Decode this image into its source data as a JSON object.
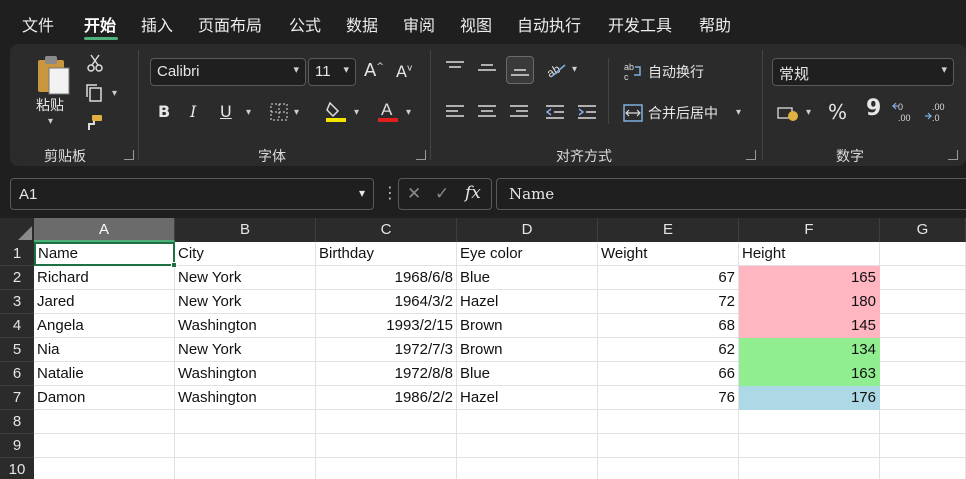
{
  "menu": {
    "items": [
      "文件",
      "开始",
      "插入",
      "页面布局",
      "公式",
      "数据",
      "审阅",
      "视图",
      "自动执行",
      "开发工具",
      "帮助"
    ],
    "active": "开始"
  },
  "ribbon": {
    "clipboard": {
      "paste_label": "粘贴",
      "group_label": "剪贴板"
    },
    "font": {
      "font_name": "Calibri",
      "font_size": "11",
      "bold": "B",
      "italic": "I",
      "underline": "U",
      "grow": "A",
      "shrink": "A",
      "font_color_letter": "A",
      "group_label": "字体",
      "highlight_color": "#f2e600",
      "font_color": "#e02020"
    },
    "alignment": {
      "wrap_label": "自动换行",
      "merge_label": "合并后居中",
      "group_label": "对齐方式"
    },
    "number": {
      "format": "常规",
      "percent": "%",
      "comma": "9",
      "group_label": "数字"
    }
  },
  "formula_bar": {
    "name_box": "A1",
    "fx_label": "fx",
    "value": "Name"
  },
  "sheet": {
    "columns": [
      "A",
      "B",
      "C",
      "D",
      "E",
      "F",
      "G"
    ],
    "rows": [
      "1",
      "2",
      "3",
      "4",
      "5",
      "6",
      "7",
      "8",
      "9",
      "10"
    ],
    "header": [
      "Name",
      "City",
      "Birthday",
      "Eye color",
      "Weight",
      "Height"
    ],
    "data": [
      [
        "Richard",
        "New York",
        "1968/6/8",
        "Blue",
        "67",
        "165"
      ],
      [
        "Jared",
        "New York",
        "1964/3/2",
        "Hazel",
        "72",
        "180"
      ],
      [
        "Angela",
        "Washington",
        "1993/2/15",
        "Brown",
        "68",
        "145"
      ],
      [
        "Nia",
        "New York",
        "1972/7/3",
        "Brown",
        "62",
        "134"
      ],
      [
        "Natalie",
        "Washington",
        "1972/8/8",
        "Blue",
        "66",
        "163"
      ],
      [
        "Damon",
        "Washington",
        "1986/2/2",
        "Hazel",
        "76",
        "176"
      ]
    ],
    "height_fill_colors": [
      "#ffb6c1",
      "#ffb6c1",
      "#ffb6c1",
      "#90ee90",
      "#90ee90",
      "#add8e6"
    ],
    "accent": "#1e7145"
  }
}
